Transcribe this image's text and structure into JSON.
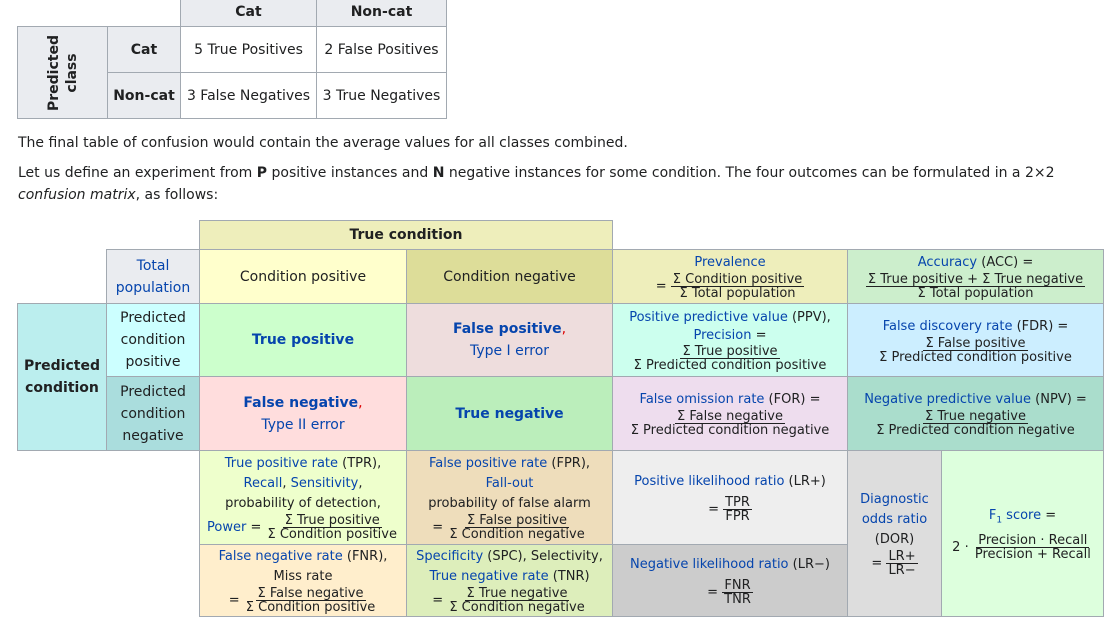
{
  "small_table": {
    "col_cat": "Cat",
    "col_noncat": "Non-cat",
    "pred_line1": "Predicted",
    "pred_line2": "class",
    "row_cat": "Cat",
    "row_noncat": "Non-cat",
    "tp": "5 True Positives",
    "fp": "2 False Positives",
    "fn": "3 False Negatives",
    "tn": "3 True Negatives"
  },
  "text": {
    "p1": "The final table of confusion would contain the average values for all classes combined.",
    "p2_a": "Let us define an experiment from ",
    "p2_P": "P",
    "p2_b": " positive instances and ",
    "p2_N": "N",
    "p2_c": " negative instances for some condition. The four outcomes can be formulated in a 2×2",
    "p2_d": "confusion matrix",
    "p2_e": ", as follows:"
  },
  "matrix": {
    "true_condition": "True condition",
    "total_population_1": "Total",
    "total_population_2": "population",
    "condition_positive": "Condition positive",
    "condition_negative": "Condition negative",
    "prevalence": "Prevalence",
    "prevalence_num": "Σ Condition positive",
    "prevalence_den": "Σ Total population",
    "accuracy": "Accuracy",
    "accuracy_abbr": " (ACC) =",
    "accuracy_num": "Σ True positive + Σ True negative",
    "accuracy_den": "Σ Total population",
    "predicted_condition_1": "Predicted",
    "predicted_condition_2": "condition",
    "pcp_1": "Predicted",
    "pcp_2": "condition",
    "pcp_3": "positive",
    "pcn_1": "Predicted",
    "pcn_2": "condition",
    "pcn_3": "negative",
    "true_positive": "True positive",
    "false_positive": "False positive",
    "type1": "Type I error",
    "false_negative": "False negative",
    "type2": "Type II error",
    "true_negative": "True negative",
    "ppv": "Positive predictive value",
    "ppv_abbr": " (PPV),",
    "precision": "Precision",
    "precision_eq": " =",
    "ppv_num": "Σ True positive",
    "ppv_den": "Σ Predicted condition positive",
    "fdr": "False discovery rate",
    "fdr_abbr": " (FDR) =",
    "fdr_num": "Σ False positive",
    "fdr_den": "Σ Predicted condition positive",
    "for": "False omission rate",
    "for_abbr": " (FOR) =",
    "for_num": "Σ False negative",
    "for_den": "Σ Predicted condition negative",
    "npv": "Negative predictive value",
    "npv_abbr": " (NPV) =",
    "npv_num": "Σ True negative",
    "npv_den": "Σ Predicted condition negative",
    "tpr": "True positive rate",
    "tpr_abbr": " (TPR),",
    "recall": "Recall",
    "sensitivity": "Sensitivity",
    "pod": "probability of detection,",
    "power": "Power",
    "tpr_num": "Σ True positive",
    "tpr_den": "Σ Condition positive",
    "fpr": "False positive rate",
    "fpr_abbr": " (FPR),",
    "fallout": "Fall-out",
    "pofa": "probability of false alarm",
    "fpr_num": "Σ False positive",
    "fpr_den": "Σ Condition negative",
    "fnr": "False negative rate",
    "fnr_abbr": " (FNR),",
    "missrate": "Miss rate",
    "fnr_num": "Σ False negative",
    "fnr_den": "Σ Condition positive",
    "specificity": "Specificity",
    "spc_abbr": " (SPC), Selectivity,",
    "tnr": "True negative rate",
    "tnr_abbr": " (TNR)",
    "tnr_num": "Σ True negative",
    "tnr_den": "Σ Condition negative",
    "plr": "Positive likelihood ratio",
    "plr_abbr": " (LR+)",
    "plr_num": "TPR",
    "plr_den": "FPR",
    "nlr": "Negative likelihood ratio",
    "nlr_abbr": " (LR−)",
    "nlr_num": "FNR",
    "nlr_den": "TNR",
    "dor_1": "Diagnostic",
    "dor_2": "odds ratio",
    "dor_3": "(DOR)",
    "dor_num": "LR+",
    "dor_den": "LR−",
    "f1": "F",
    "f1_sub": "1",
    "f1_score": " score",
    "f1_eq": " =",
    "f1_two": "2 ·",
    "f1_num": "Precision · Recall",
    "f1_den": "Precision + Recall",
    "eq": "=",
    "comma": ","
  },
  "colors": {
    "border": "#a2a9b1",
    "header_grey": "#eaecf0",
    "true_condition_bg": "#eeeebb",
    "cond_pos_bg": "#ffffcc",
    "cond_neg_bg": "#dddd99",
    "predicted_cond_bg": "#bbeeee",
    "pcp_bg": "#ccffff",
    "pcn_bg": "#aadddd",
    "tp_bg": "#ccffcc",
    "fp_bg": "#eedddd",
    "fn_bg": "#ffdddd",
    "tn_bg": "#bbeebb",
    "link": "#0645ad",
    "fp_red": "#dd0000"
  }
}
